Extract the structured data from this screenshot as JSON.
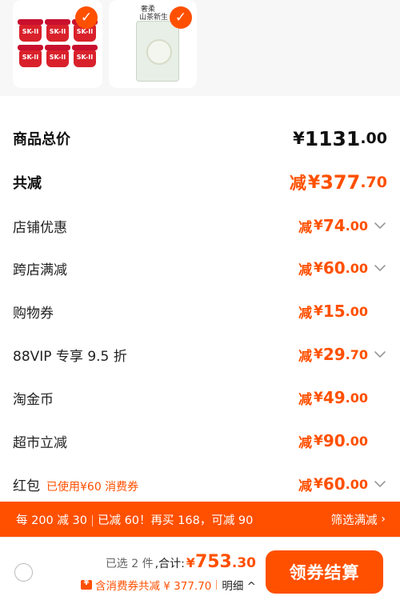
{
  "products": {
    "item1": {
      "jar_text": "SK-II"
    },
    "item2": {
      "line1": "奢柔",
      "line2": "山茶新生"
    }
  },
  "summary": {
    "total_price": {
      "label": "商品总价",
      "yen": "¥",
      "int": "1131",
      "dec": ".00"
    },
    "total_reduction": {
      "label": "共减",
      "jian": "减",
      "yen": "¥",
      "int": "377",
      "dec": ".70"
    },
    "rows": [
      {
        "label": "店铺优惠",
        "jian": "减",
        "yen": "¥",
        "int": "74",
        "dec": ".00",
        "chevron": true
      },
      {
        "label": "跨店满减",
        "jian": "减",
        "yen": "¥",
        "int": "60",
        "dec": ".00",
        "chevron": true
      },
      {
        "label": "购物券",
        "jian": "减",
        "yen": "¥",
        "int": "15",
        "dec": ".00",
        "chevron": false
      },
      {
        "label": "88VIP 专享 9.5 折",
        "jian": "减",
        "yen": "¥",
        "int": "29",
        "dec": ".70",
        "chevron": true
      },
      {
        "label": "淘金币",
        "jian": "减",
        "yen": "¥",
        "int": "49",
        "dec": ".00",
        "chevron": false
      },
      {
        "label": "超市立减",
        "jian": "减",
        "yen": "¥",
        "int": "90",
        "dec": ".00",
        "chevron": false
      },
      {
        "label": "红包",
        "note": "已使用¥60 消费券",
        "jian": "减",
        "yen": "¥",
        "int": "60",
        "dec": ".00",
        "chevron": true
      }
    ]
  },
  "promo": {
    "part1": "每 200 减 30",
    "part2": "已减 60！再买 168，可减 90",
    "action": "筛选满减",
    "arrow": "›"
  },
  "bottom": {
    "selected": "已选 2 件",
    "sum_label": ",合计:",
    "yen": "¥",
    "int": "753",
    "dec": ".30",
    "discount_text": "含消费券共减 ¥ 377.70",
    "detail": "明细 ^",
    "checkout": "领券结算"
  },
  "colors": {
    "accent": "#ff5000",
    "text": "#222222"
  },
  "icons": {
    "check": "check-icon",
    "chevron": "chevron-down-icon",
    "coupon": "coupon-icon"
  }
}
